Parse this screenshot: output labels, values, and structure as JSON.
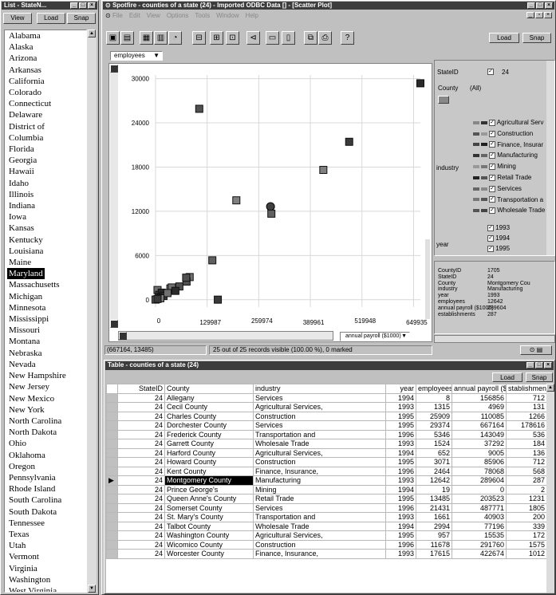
{
  "list_window": {
    "title": "List - StateN...",
    "view": "View",
    "load": "Load",
    "snap": "Snap",
    "states": [
      "Alabama",
      "Alaska",
      "Arizona",
      "Arkansas",
      "California",
      "Colorado",
      "Connecticut",
      "Delaware",
      "District of",
      "Columbia",
      "Florida",
      "Georgia",
      "Hawaii",
      "Idaho",
      "Illinois",
      "Indiana",
      "Iowa",
      "Kansas",
      "Kentucky",
      "Louisiana",
      "Maine",
      "Maryland",
      "Massachusetts",
      "Michigan",
      "Minnesota",
      "Mississippi",
      "Missouri",
      "Montana",
      "Nebraska",
      "Nevada",
      "New Hampshire",
      "New Jersey",
      "New Mexico",
      "New York",
      "North Carolina",
      "North Dakota",
      "Ohio",
      "Oklahoma",
      "Oregon",
      "Pennsylvania",
      "Rhode Island",
      "South Carolina",
      "South Dakota",
      "Tennessee",
      "Texas",
      "Utah",
      "Vermont",
      "Virginia",
      "Washington",
      "West Virginia"
    ],
    "selected": "Maryland"
  },
  "main_window": {
    "title": "Spotfire - counties of a state (24) - Imported ODBC Data [] - [Scatter Plot]",
    "menu": [
      "File",
      "Edit",
      "View",
      "Options",
      "Tools",
      "Window",
      "Help"
    ],
    "load": "Load",
    "snap": "Snap",
    "y_axis_select": "employees",
    "x_axis_select": "annual payroll ($1000)",
    "coord_readout": "(667164, 13485)",
    "status": "25 out of 25 records visible (100.00 %), 0 marked"
  },
  "chart_data": {
    "type": "scatter",
    "xlabel": "annual payroll ($1000)",
    "ylabel": "employees",
    "xlim": [
      0,
      667164
    ],
    "ylim": [
      -1000,
      30500
    ],
    "x_ticks": [
      "0",
      "129987",
      "259974",
      "389961",
      "519948",
      "649935"
    ],
    "y_ticks": [
      "30000",
      "24000",
      "18000",
      "12000",
      "6000",
      "0"
    ],
    "points": [
      {
        "x": 156856,
        "y": 8
      },
      {
        "x": 4969,
        "y": 1315
      },
      {
        "x": 110085,
        "y": 25909
      },
      {
        "x": 667164,
        "y": 29374
      },
      {
        "x": 143049,
        "y": 5346
      },
      {
        "x": 37292,
        "y": 1524
      },
      {
        "x": 9005,
        "y": 652
      },
      {
        "x": 85906,
        "y": 3071
      },
      {
        "x": 78068,
        "y": 2464
      },
      {
        "x": 289604,
        "y": 12642
      },
      {
        "x": 0,
        "y": 19
      },
      {
        "x": 203523,
        "y": 13485
      },
      {
        "x": 487771,
        "y": 21431
      },
      {
        "x": 40903,
        "y": 1661
      },
      {
        "x": 77196,
        "y": 2994
      },
      {
        "x": 15535,
        "y": 957
      },
      {
        "x": 291760,
        "y": 11678
      },
      {
        "x": 422674,
        "y": 17615
      },
      {
        "x": 20000,
        "y": 500
      },
      {
        "x": 30000,
        "y": 900
      },
      {
        "x": 60000,
        "y": 1800
      },
      {
        "x": 50000,
        "y": 1200
      },
      {
        "x": 8000,
        "y": 300
      },
      {
        "x": 12000,
        "y": 200
      },
      {
        "x": 5000,
        "y": 100
      }
    ]
  },
  "query_panel": {
    "stateid_label": "StateID",
    "stateid_value": "24",
    "county_label": "County",
    "county_value": "(All)",
    "industry_label": "industry",
    "industries": [
      "Agricultural Serv",
      "Construction",
      "Finance, Insurar",
      "Manufacturing",
      "Mining",
      "Retail Trade",
      "Services",
      "Transportation a",
      "Wholesale Trade"
    ],
    "year_label": "year",
    "years": [
      "1993",
      "1994",
      "1995"
    ]
  },
  "details": {
    "labels": [
      "CountyID",
      "StateID",
      "County",
      "industry",
      "year",
      "employees",
      "annual payroll ($1000)",
      "establishments"
    ],
    "values": [
      "1705",
      "24",
      "Montgomery Cou",
      "Manufacturing",
      "1993",
      "12642",
      "289604",
      "287"
    ]
  },
  "table_window": {
    "title": "Table - counties of a state (24)",
    "load": "Load",
    "snap": "Snap",
    "columns": [
      "StateID",
      "County",
      "industry",
      "year",
      "employees",
      "annual payroll ($1000)",
      "stablishments"
    ],
    "rows": [
      [
        "24",
        "Allegany",
        "Services",
        "1994",
        "8",
        "156856",
        "712"
      ],
      [
        "24",
        "Cecil County",
        "Agricultural Services,",
        "1993",
        "1315",
        "4969",
        "131"
      ],
      [
        "24",
        "Charles County",
        "Construction",
        "1995",
        "25909",
        "110085",
        "1266"
      ],
      [
        "24",
        "Dorchester County",
        "Services",
        "1995",
        "29374",
        "667164",
        "178616"
      ],
      [
        "24",
        "Frederick County",
        "Transportation and",
        "1996",
        "5346",
        "143049",
        "536"
      ],
      [
        "24",
        "Garrett County",
        "Wholesale Trade",
        "1993",
        "1524",
        "37292",
        "184"
      ],
      [
        "24",
        "Harford County",
        "Agricultural Services,",
        "1994",
        "652",
        "9005",
        "136"
      ],
      [
        "24",
        "Howard County",
        "Construction",
        "1995",
        "3071",
        "85906",
        "712"
      ],
      [
        "24",
        "Kent County",
        "Finance, Insurance,",
        "1996",
        "2464",
        "78068",
        "568"
      ],
      [
        "24",
        "Montgomery County",
        "Manufacturing",
        "1993",
        "12642",
        "289604",
        "287"
      ],
      [
        "24",
        "Prince George's",
        "Mining",
        "1994",
        "19",
        "0",
        "2"
      ],
      [
        "24",
        "Queen Anne's County",
        "Retail Trade",
        "1995",
        "13485",
        "203523",
        "1231"
      ],
      [
        "24",
        "Somerset County",
        "Services",
        "1996",
        "21431",
        "487771",
        "1805"
      ],
      [
        "24",
        "St. Mary's County",
        "Transportation and",
        "1993",
        "1661",
        "40903",
        "200"
      ],
      [
        "24",
        "Talbot County",
        "Wholesale Trade",
        "1994",
        "2994",
        "77196",
        "339"
      ],
      [
        "24",
        "Washington County",
        "Agricultural Services,",
        "1995",
        "957",
        "15535",
        "172"
      ],
      [
        "24",
        "Wicomico County",
        "Construction",
        "1996",
        "11678",
        "291760",
        "1575"
      ],
      [
        "24",
        "Worcester County",
        "Finance, Insurance,",
        "1993",
        "17615",
        "422674",
        "1012"
      ]
    ],
    "selected_row": 9
  }
}
